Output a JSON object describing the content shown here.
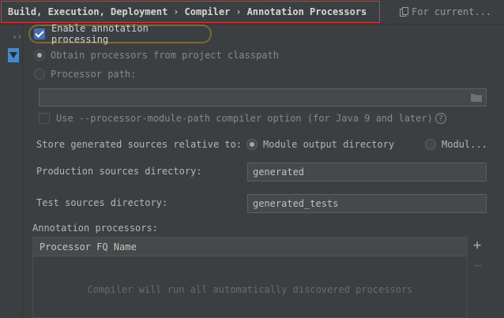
{
  "breadcrumb": [
    "Build, Execution, Deployment",
    "Compiler",
    "Annotation Processors"
  ],
  "breadcrumb_separator": "›",
  "for_current": "For current...",
  "enable_processing": {
    "label": "Enable annotation processing",
    "checked": true
  },
  "processor_source": {
    "classpath_label": "Obtain processors from project classpath",
    "path_label": "Processor path:",
    "path_value": ""
  },
  "module_path_option": {
    "label": "Use --processor-module-path compiler option (for Java 9 and later)",
    "help": "?"
  },
  "store_generated": {
    "label": "Store generated sources relative to:",
    "option_module_output": "Module output directory",
    "option_module_content": "Modul..."
  },
  "production_dir": {
    "label": "Production sources directory:",
    "value": "generated"
  },
  "test_dir": {
    "label": "Test sources directory:",
    "value": "generated_tests"
  },
  "annotation_processors": {
    "label": "Annotation processors:",
    "column_header": "Processor FQ Name",
    "empty_text": "Compiler will run all automatically discovered processors",
    "add": "+",
    "remove": "−"
  },
  "left_strip": {
    "expand_glyph": "››"
  },
  "colors": {
    "accent": "#4b6eaf",
    "highlight_border": "#e3342f",
    "focus_ring": "#7a6a3a",
    "background": "#3c3f41"
  }
}
